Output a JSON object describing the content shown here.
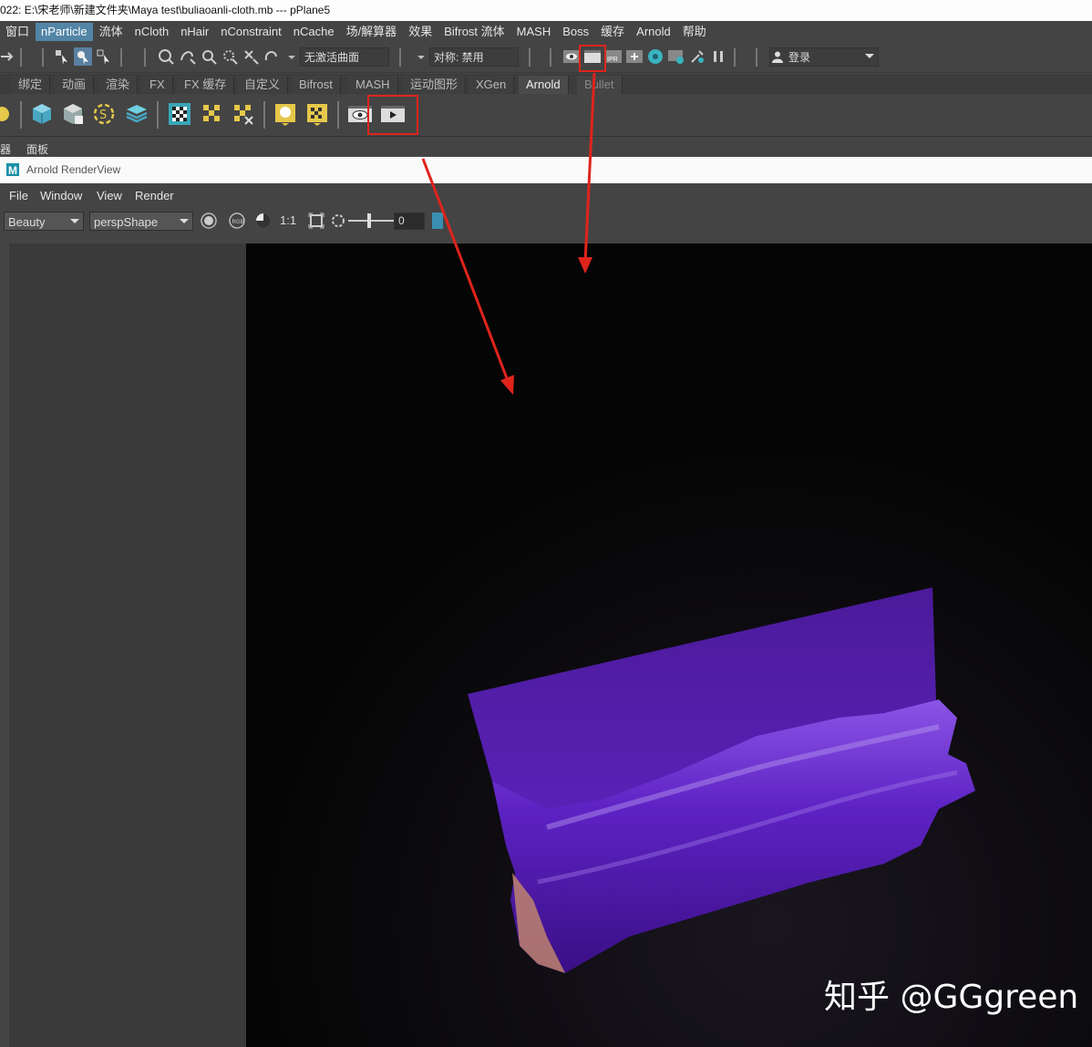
{
  "window": {
    "title": "022: E:\\宋老师\\新建文件夹\\Maya test\\buliaoanli-cloth.mb  ---   pPlane5"
  },
  "menubar": {
    "items": [
      "窗口",
      "nParticle",
      "流体",
      "nCloth",
      "nHair",
      "nConstraint",
      "nCache",
      "场/解算器",
      "效果",
      "Bifrost 流体",
      "MASH",
      "Boss",
      "缓存",
      "Arnold",
      "帮助"
    ],
    "active_index": 1
  },
  "statusline": {
    "live_surface": "无激活曲面",
    "symmetry": "对称: 禁用",
    "login": "登录"
  },
  "shelf_tabs": {
    "items": [
      "绑定",
      "动画",
      "渲染",
      "FX",
      "FX 缓存",
      "自定义",
      "Bifrost",
      "MASH",
      "运动图形",
      "XGen",
      "Arnold",
      "Bullet"
    ],
    "active": "Arnold"
  },
  "panel_menu": {
    "left_label": "器",
    "panels_label": "面板"
  },
  "render_view": {
    "title": "Arnold RenderView",
    "logo_letter": "M",
    "menu": [
      "File",
      "Window",
      "View",
      "Render"
    ],
    "aov": "Beauty",
    "camera": "perspShape",
    "ratio_label": "1:1",
    "rgb_label": "RGB",
    "exposure_value": "0"
  },
  "watermark": "知乎 @GGgreen",
  "colors": {
    "highlight": "#e0241c",
    "active_menu": "#5285a6",
    "cloth": "#5a1fa8"
  }
}
